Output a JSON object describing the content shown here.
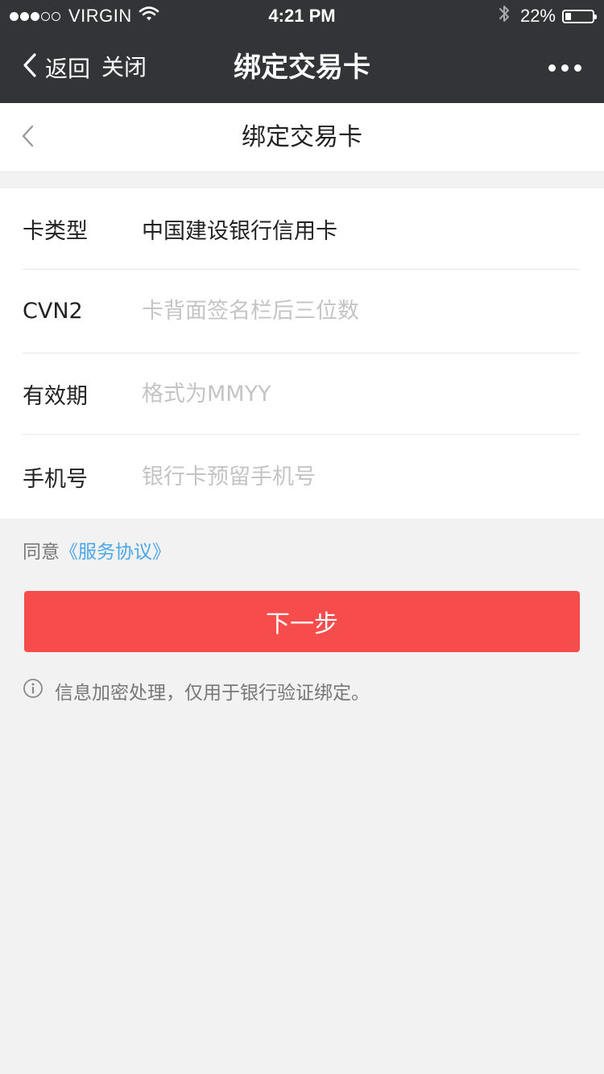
{
  "status_bar": {
    "carrier": "VIRGIN",
    "time": "4:21 PM",
    "battery": "22%",
    "battery_level": 0.22,
    "icons": [
      "signal-dots-icon",
      "wifi-icon",
      "bluetooth-icon",
      "battery-icon"
    ]
  },
  "nav": {
    "back_label": "返回",
    "close_label": "关闭",
    "title": "绑定交易卡",
    "icons": [
      "back-chevron-icon",
      "more-dots-icon"
    ]
  },
  "page_header": {
    "title": "绑定交易卡",
    "icons": [
      "back-chevron-icon"
    ]
  },
  "form": {
    "card_type": {
      "label": "卡类型",
      "value": "中国建设银行信用卡"
    },
    "cvn2": {
      "label": "CVN2",
      "value": "",
      "placeholder": "卡背面签名栏后三位数"
    },
    "expiry": {
      "label": "有效期",
      "value": "",
      "placeholder": "格式为MMYY"
    },
    "phone": {
      "label": "手机号",
      "value": "",
      "placeholder": "银行卡预留手机号"
    }
  },
  "agreement": {
    "prefix": "同意",
    "link": "《服务协议》"
  },
  "next_button": {
    "label": "下一步"
  },
  "notice": {
    "icon": "info-icon",
    "text": "信息加密处理，仅用于银行验证绑定。"
  },
  "colors": {
    "nav_background": "#333437",
    "primary_button": "#f64c4c",
    "link": "#4ba6e8",
    "page_background": "#f2f2f2",
    "placeholder": "#c4c4c4"
  }
}
